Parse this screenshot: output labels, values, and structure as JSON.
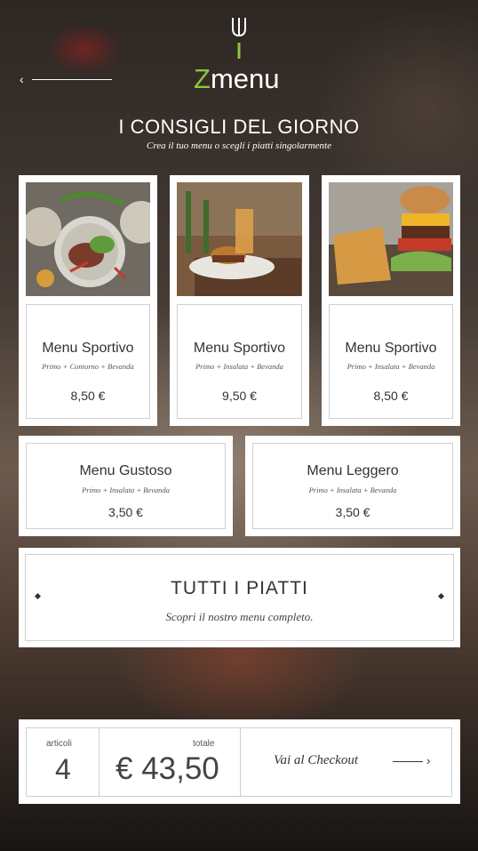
{
  "header": {
    "logo_prefix": "Z",
    "logo_suffix": "menu",
    "logo_accent_color": "#8cc63f",
    "back_icon": "chevron-left-icon",
    "brand_icon": "fork-icon"
  },
  "intro": {
    "title": "I CONSIGLI DEL GIORNO",
    "subtitle": "Crea il tuo menu o scegli i piatti singolarmente"
  },
  "featured": [
    {
      "name": "Menu Sportivo",
      "items": "Primo + Contorno + Bevanda",
      "price": "8,50 €",
      "image": "salad-steak-image"
    },
    {
      "name": "Menu Sportivo",
      "items": "Primo + Insalata + Bevanda",
      "price": "9,50 €",
      "image": "burger-drink-image"
    },
    {
      "name": "Menu Sportivo",
      "items": "Primo + Insalata + Bevanda",
      "price": "8,50 €",
      "image": "burger-fries-image"
    }
  ],
  "secondary": [
    {
      "name": "Menu Gustoso",
      "items": "Primo + Insalata + Bevanda",
      "price": "3,50 €"
    },
    {
      "name": "Menu Leggero",
      "items": "Primo + Insalata + Bevanda",
      "price": "3,50 €"
    }
  ],
  "all_dishes": {
    "title": "TUTTI I PIATTI",
    "subtitle": "Scopri il nostro menu completo."
  },
  "cart": {
    "items_label": "articoli",
    "items_count": "4",
    "total_label": "totale",
    "total_value": "€ 43,50",
    "checkout_label": "Vai al Checkout",
    "checkout_icon": "arrow-right-icon"
  }
}
